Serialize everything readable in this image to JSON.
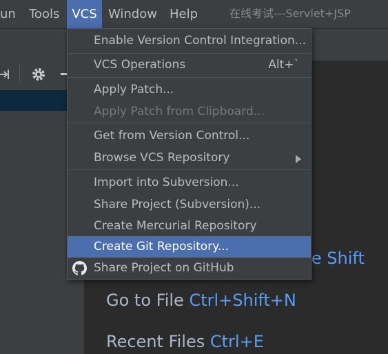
{
  "menubar": {
    "items": [
      "Run",
      "Tools",
      "VCS",
      "Window",
      "Help"
    ],
    "visible_items": [
      "Run-partial:un",
      "Tools",
      "VCS",
      "Window",
      "Help"
    ],
    "run_label": "un",
    "tools_label": "Tools",
    "vcs_label": "VCS",
    "window_label": "Window",
    "help_label": "Help",
    "title": "在线考试---Servlet+JSP"
  },
  "colors": {
    "accent": "#4b6eaf",
    "shortcut_blue": "#589df6"
  },
  "vcs_menu": {
    "items": [
      {
        "label": "Enable Version Control Integration...",
        "enabled": true
      },
      {
        "label": "VCS Operations",
        "shortcut": "Alt+`",
        "enabled": true
      },
      {
        "label": "Apply Patch...",
        "enabled": true
      },
      {
        "label": "Apply Patch from Clipboard...",
        "enabled": false
      },
      {
        "label": "Get from Version Control...",
        "enabled": true
      },
      {
        "label": "Browse VCS Repository",
        "submenu": true,
        "enabled": true
      },
      {
        "label": "Import into Subversion...",
        "enabled": true
      },
      {
        "label": "Share Project (Subversion)...",
        "enabled": true
      },
      {
        "label": "Create Mercurial Repository",
        "enabled": true
      },
      {
        "label": "Create Git Repository...",
        "enabled": true,
        "highlighted": true
      },
      {
        "label": "Share Project on GitHub",
        "icon": "github-icon",
        "enabled": true
      }
    ]
  },
  "welcome": {
    "search_everywhere_key_fragment": "ble Shift",
    "goto_file_label": "Go to File",
    "goto_file_key": "Ctrl+Shift+N",
    "recent_files_label": "Recent Files",
    "recent_files_key": "Ctrl+E"
  }
}
